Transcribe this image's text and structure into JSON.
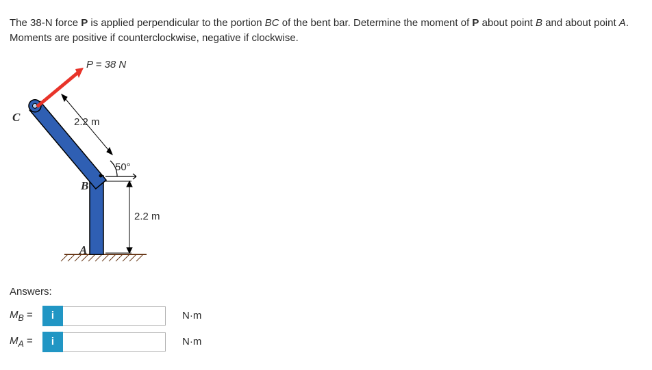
{
  "problem": {
    "p1": "The 38-N force ",
    "p2_bold": "P",
    "p3": " is applied perpendicular to the portion ",
    "p4_ital": "BC",
    "p5": " of the bent bar. Determine the moment of ",
    "p6_bold": "P",
    "p7": " about point ",
    "p8_ital": "B",
    "p9": " and about point ",
    "p10_ital": "A",
    "p11": ". Moments are positive if counterclockwise, negative if clockwise."
  },
  "figure": {
    "force_label": "P = 38 N",
    "length_bc": "2.2 m",
    "length_ab": "2.2 m",
    "angle": "50°",
    "point_A": "A",
    "point_B": "B",
    "point_C": "C"
  },
  "answers": {
    "heading": "Answers:",
    "icon_text": "i",
    "rows": [
      {
        "var_sym": "M",
        "var_sub": "B",
        "unit": "N·m",
        "value": ""
      },
      {
        "var_sym": "M",
        "var_sub": "A",
        "unit": "N·m",
        "value": ""
      }
    ],
    "equals": "="
  }
}
